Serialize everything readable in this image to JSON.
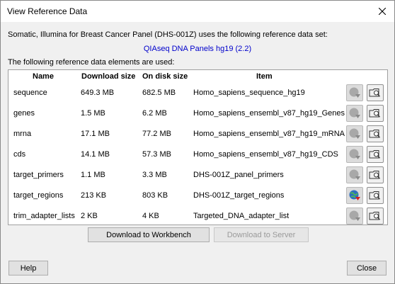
{
  "window": {
    "title": "View Reference Data",
    "description": "Somatic, Illumina for Breast Cancer Panel (DHS-001Z) uses the following reference data set:",
    "reference_set": "QIAseq DNA Panels hg19 (2.2)",
    "elements_label": "The following reference data elements are used:"
  },
  "table": {
    "columns": [
      "Name",
      "Download size",
      "On disk size",
      "Item"
    ],
    "rows": [
      {
        "name": "sequence",
        "download": "649.3 MB",
        "disk": "682.5 MB",
        "item": "Homo_sapiens_sequence_hg19",
        "downloaded": false
      },
      {
        "name": "genes",
        "download": "1.5 MB",
        "disk": "6.2 MB",
        "item": "Homo_sapiens_ensembl_v87_hg19_Genes",
        "downloaded": false
      },
      {
        "name": "mrna",
        "download": "17.1 MB",
        "disk": "77.2 MB",
        "item": "Homo_sapiens_ensembl_v87_hg19_mRNA",
        "downloaded": false
      },
      {
        "name": "cds",
        "download": "14.1 MB",
        "disk": "57.3 MB",
        "item": "Homo_sapiens_ensembl_v87_hg19_CDS",
        "downloaded": false
      },
      {
        "name": "target_primers",
        "download": "1.1 MB",
        "disk": "3.3 MB",
        "item": "DHS-001Z_panel_primers",
        "downloaded": false
      },
      {
        "name": "target_regions",
        "download": "213 KB",
        "disk": "803 KB",
        "item": "DHS-001Z_target_regions",
        "downloaded": true
      },
      {
        "name": "trim_adapter_lists",
        "download": "2 KB",
        "disk": "4 KB",
        "item": "Targeted_DNA_adapter_list",
        "downloaded": false
      }
    ]
  },
  "buttons": {
    "download_workbench": "Download to Workbench",
    "download_server": "Download to Server",
    "help": "Help",
    "close": "Close"
  },
  "colors": {
    "link": "#0000cc",
    "window_bg": "#f0f0f0"
  }
}
